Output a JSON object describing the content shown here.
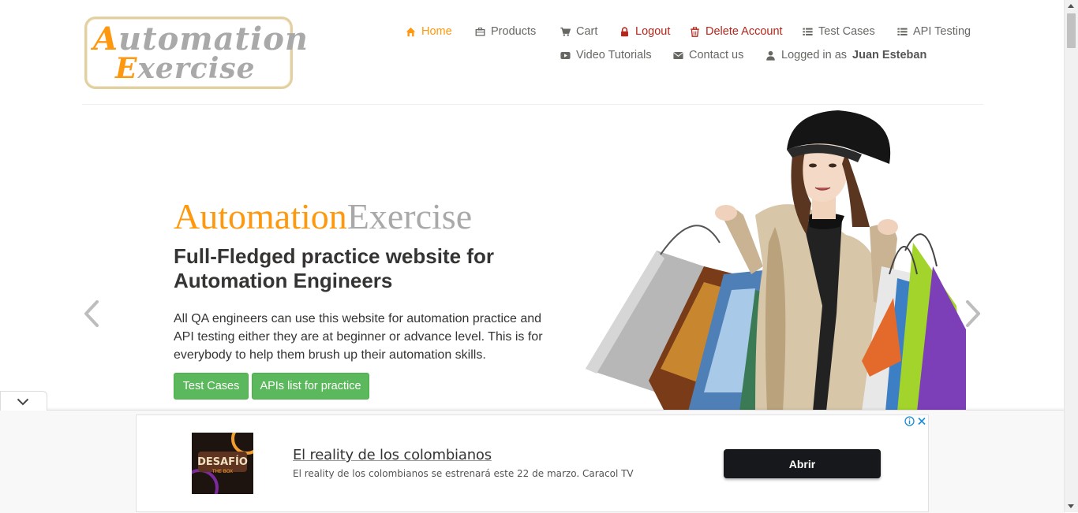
{
  "logo": {
    "line1_cap": "A",
    "line1_rest": "utomation",
    "line2_cap": "E",
    "line2_rest": "xercise"
  },
  "nav": {
    "home": "Home",
    "products": "Products",
    "cart": "Cart",
    "logout": "Logout",
    "delete_account": "Delete Account",
    "test_cases": "Test Cases",
    "api_testing": "API Testing",
    "video_tutorials": "Video Tutorials",
    "contact_us": "Contact us",
    "logged_in_prefix": "Logged in as",
    "logged_in_user": "Juan Esteban"
  },
  "hero": {
    "brand_part1": "Automation",
    "brand_part2": "Exercise",
    "heading": "Full-Fledged practice website for Automation Engineers",
    "description": "All QA engineers can use this website for automation practice and API testing either they are at beginner or advance level. This is for everybody to help them brush up their automation skills.",
    "btn_test_cases": "Test Cases",
    "btn_apis": "APIs list for practice"
  },
  "ad": {
    "thumb_text_1": "DESAFÍO",
    "thumb_text_2": "THE BOX",
    "title": "El reality de los colombianos",
    "subtitle": "El reality de los colombianos se estrenará este 22 de marzo. Caracol TV",
    "cta": "Abrir"
  },
  "colors": {
    "accent": "#fe980f",
    "brand_gray": "#a9a9a9",
    "danger": "#b5261c",
    "button_green": "#5cb85c",
    "ad_button": "#17181b"
  },
  "icons": [
    "home-icon",
    "briefcase-icon",
    "cart-icon",
    "lock-icon",
    "trash-icon",
    "list-icon",
    "youtube-icon",
    "envelope-icon",
    "user-icon",
    "chevron-left-icon",
    "chevron-right-icon",
    "chevron-down-icon",
    "info-icon",
    "close-icon"
  ]
}
